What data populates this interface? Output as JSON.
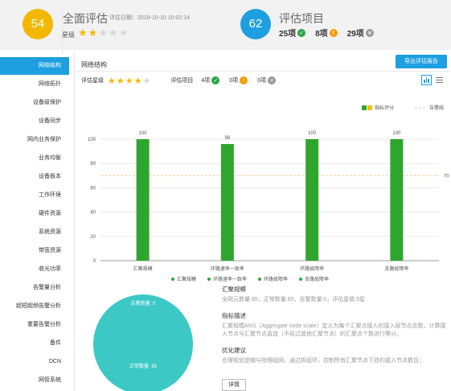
{
  "header": {
    "overall_score": "54",
    "overall_title": "全面评估",
    "date_label": "评估日期：2018-10-10 10:02:14",
    "star_label": "星级",
    "stars_filled": 2,
    "stars_total": 5,
    "items_count": "62",
    "items_title": "评估项目",
    "pass_count": "25项",
    "warn_count": "8项",
    "fail_count": "29项"
  },
  "sidebar": {
    "items": [
      {
        "label": "网络结构"
      },
      {
        "label": "网络拓扑"
      },
      {
        "label": "设备级保护"
      },
      {
        "label": "设备同步"
      },
      {
        "label": "网内业务保护"
      },
      {
        "label": "业务均衡"
      },
      {
        "label": "设备板本"
      },
      {
        "label": "工作环境"
      },
      {
        "label": "硬件资源"
      },
      {
        "label": "系统资源"
      },
      {
        "label": "带宽资源"
      },
      {
        "label": "收光功率"
      },
      {
        "label": "告警量分析"
      },
      {
        "label": "超短超频告警分析"
      },
      {
        "label": "重要告警分析"
      },
      {
        "label": "备件"
      },
      {
        "label": "DCN"
      },
      {
        "label": "网管系统"
      }
    ]
  },
  "panel": {
    "title": "网络结构",
    "export_label": "导出评估报告",
    "rating_label": "评估星级",
    "stars_filled": 4,
    "stars_total": 5,
    "items_label": "评估项目",
    "pass": "4项",
    "warn": "0项",
    "fail": "0项"
  },
  "chart_data": {
    "type": "bar",
    "categories": [
      "汇聚规模",
      "环路速率一致率",
      "环路故障率",
      "支路故障率"
    ],
    "series": [
      {
        "name": "指标评分",
        "values": [
          100,
          96,
          100,
          100
        ]
      }
    ],
    "threshold": {
      "name": "告警线",
      "value": 70
    },
    "ylim": [
      0,
      100
    ],
    "yticks": [
      0,
      20,
      40,
      60,
      80,
      100
    ],
    "legend_position": "top-right",
    "colors": {
      "bar": "#2ea62e",
      "threshold": "#f5c99a",
      "legend_alt": "#f2c200"
    }
  },
  "bottom": {
    "legend": [
      "汇聚规模",
      "环路速率一致率",
      "环路故障率",
      "支路故障率"
    ],
    "pie": {
      "label_top": "告警数量: 0",
      "label_bottom": "正常数量: 85",
      "color": "#3cc9c6"
    },
    "sections": [
      {
        "title": "汇聚规模",
        "text": "全网元数量:85，正常数量:85，告警数量:0，评估星级:5星"
      },
      {
        "title": "指标描述",
        "text": "汇聚规模ANS（Aggregate node scale）定义为每个汇聚点接入的接入层节点总数，计算接入节点与汇聚节点直连（不经过其他汇聚节点）的汇聚点个数进行等分。"
      },
      {
        "title": "优化建议",
        "text": "合理规划逻辑与物理组网，通过拆组环，控制所有汇聚节点下挂的接入节点数目；"
      }
    ],
    "details_label": "详情"
  }
}
